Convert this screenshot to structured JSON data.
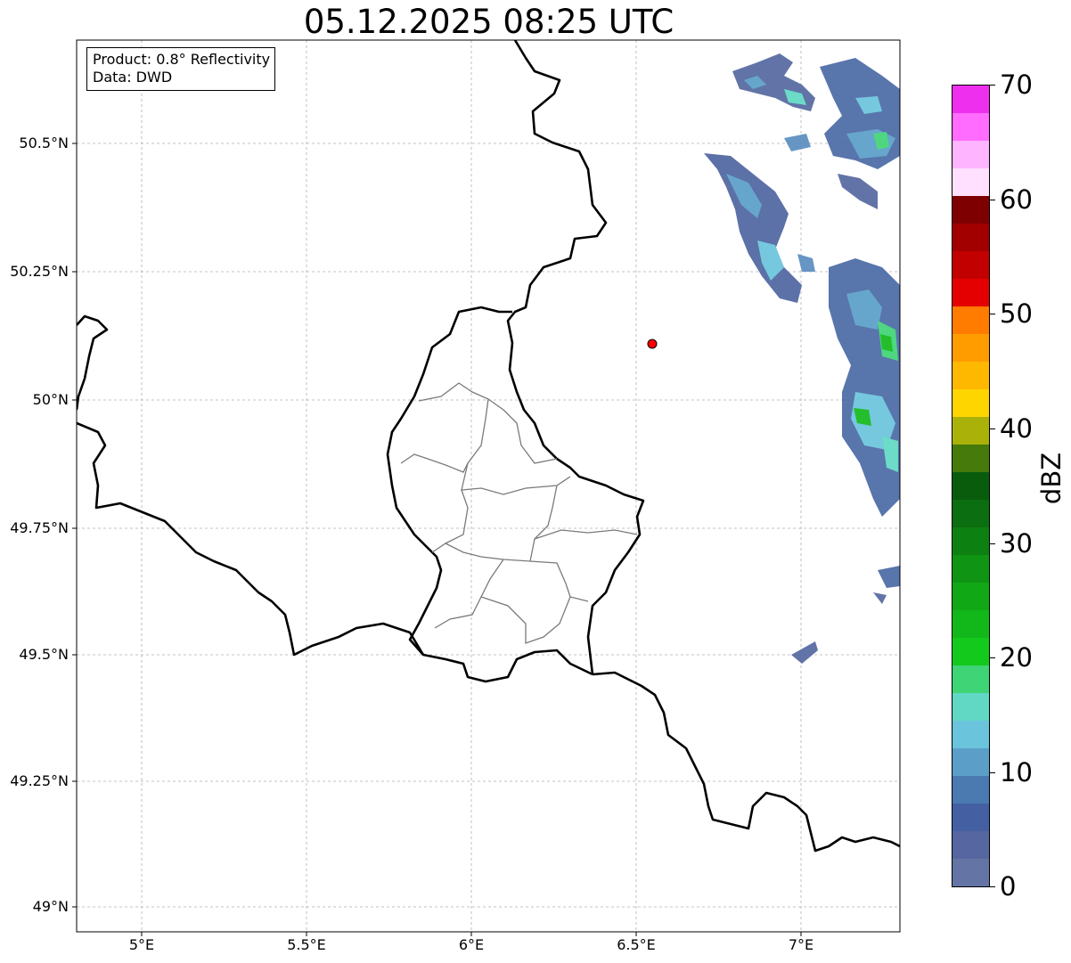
{
  "title": "05.12.2025 08:25 UTC",
  "infobox": {
    "product": "Product: 0.8° Reflectivity",
    "data": "Data: DWD"
  },
  "axes": {
    "lat_labels": [
      "50.5°N",
      "50.25°N",
      "50°N",
      "49.75°N",
      "49.5°N",
      "49.25°N",
      "49°N"
    ],
    "lon_labels": [
      "5°E",
      "5.5°E",
      "6°E",
      "6.5°E",
      "7°E"
    ]
  },
  "colorbar": {
    "unit": "dBZ",
    "tick_labels": [
      "70",
      "60",
      "50",
      "40",
      "30",
      "20",
      "10",
      "0"
    ],
    "colors_bottom_to_top": [
      "#6474a4",
      "#5566a0",
      "#4460a3",
      "#4a7ab0",
      "#5b9fc8",
      "#6ac4dc",
      "#60d8c4",
      "#3fd476",
      "#12c91c",
      "#12b81a",
      "#11a816",
      "#0f9414",
      "#0d8012",
      "#0b6e10",
      "#085c0c",
      "#467a0a",
      "#aab20a",
      "#ffd500",
      "#ffb800",
      "#ff9c00",
      "#ff7c00",
      "#e40000",
      "#c20000",
      "#a20000",
      "#7e0000",
      "#ffe0ff",
      "#ffb4ff",
      "#ff6cff",
      "#ee30ee"
    ]
  },
  "marker": {
    "name": "radar-site",
    "color": "#ff0000"
  }
}
